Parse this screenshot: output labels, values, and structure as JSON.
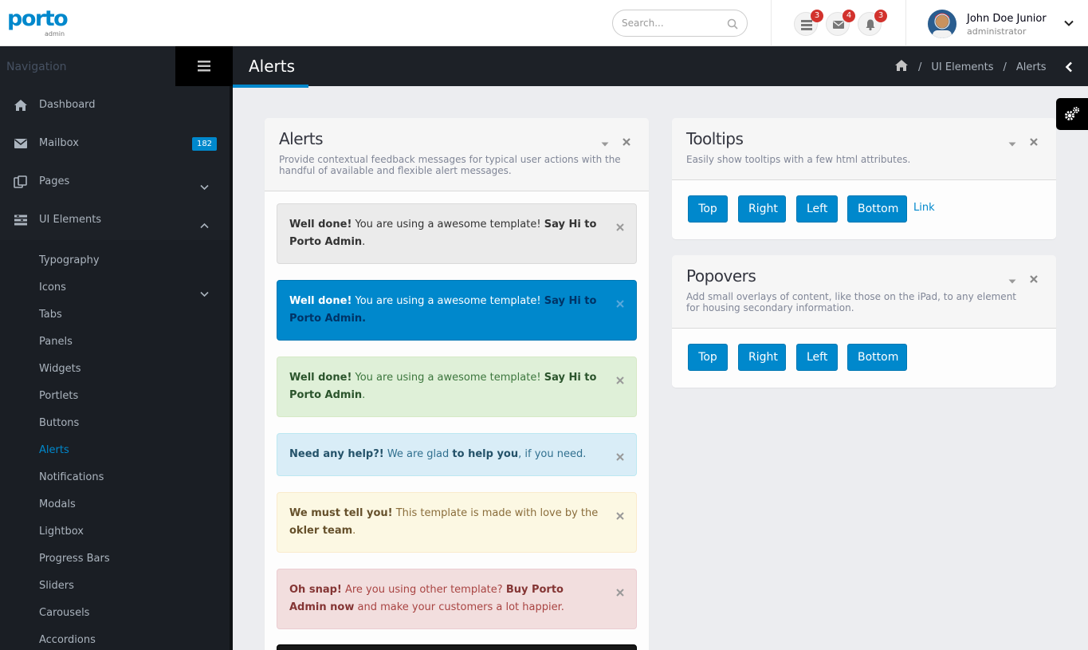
{
  "app": {
    "logo_text": "porto",
    "logo_sub": "admin",
    "accent_color": "#0088cc"
  },
  "header": {
    "search_placeholder": "Search...",
    "notifications": [
      {
        "icon": "tasks-icon",
        "count": "3"
      },
      {
        "icon": "envelope-icon",
        "count": "4"
      },
      {
        "icon": "bell-icon",
        "count": "3"
      }
    ],
    "user": {
      "name": "John Doe Junior",
      "role": "administrator"
    }
  },
  "sidebar": {
    "title": "Navigation",
    "items": [
      {
        "label": "Dashboard",
        "icon": "home-icon"
      },
      {
        "label": "Mailbox",
        "icon": "envelope-icon",
        "badge": "182"
      },
      {
        "label": "Pages",
        "icon": "copy-icon"
      },
      {
        "label": "UI Elements",
        "icon": "tasks-icon"
      }
    ],
    "sub_items": [
      "Typography",
      "Icons",
      "Tabs",
      "Panels",
      "Widgets",
      "Portlets",
      "Buttons",
      "Alerts",
      "Notifications",
      "Modals",
      "Lightbox",
      "Progress Bars",
      "Sliders",
      "Carousels",
      "Accordions"
    ],
    "active_sub_item": "Alerts"
  },
  "page": {
    "title": "Alerts",
    "breadcrumb": [
      "UI Elements",
      "Alerts"
    ]
  },
  "alerts_panel": {
    "title": "Alerts",
    "subtitle": "Provide contextual feedback messages for typical user actions with the handful of available and flexible alert messages.",
    "alerts": [
      {
        "strong": "Well done!",
        "text": " You are using a awesome template! ",
        "strong2": "Say Hi to Porto Admin",
        "end": "."
      },
      {
        "strong": "Well done!",
        "text": " You are using a awesome template! ",
        "strong2": "Say Hi to Porto Admin",
        "end": "."
      },
      {
        "strong": "Well done!",
        "text": " You are using a awesome template! ",
        "strong2": "Say Hi to Porto Admin",
        "end": "."
      },
      {
        "strong": "Need any help?!",
        "text": " We are glad ",
        "strong2": "to help you",
        "end": ", if you need."
      },
      {
        "strong": "We must tell you!",
        "text": " This template is made with love by the ",
        "strong2": "okler team",
        "end": "."
      },
      {
        "strong": "Oh snap!",
        "text": " Are you using other template? ",
        "strong2": "Buy Porto Admin now",
        "end": " and make your customers a lot happier."
      }
    ]
  },
  "tooltips_panel": {
    "title": "Tooltips",
    "subtitle": "Easily show tooltips with a few html attributes.",
    "buttons": [
      "Top",
      "Right",
      "Left",
      "Bottom"
    ],
    "link": "Link"
  },
  "popovers_panel": {
    "title": "Popovers",
    "subtitle": "Add small overlays of content, like those on the iPad, to any element for housing secondary information.",
    "buttons": [
      "Top",
      "Right",
      "Left",
      "Bottom"
    ]
  }
}
